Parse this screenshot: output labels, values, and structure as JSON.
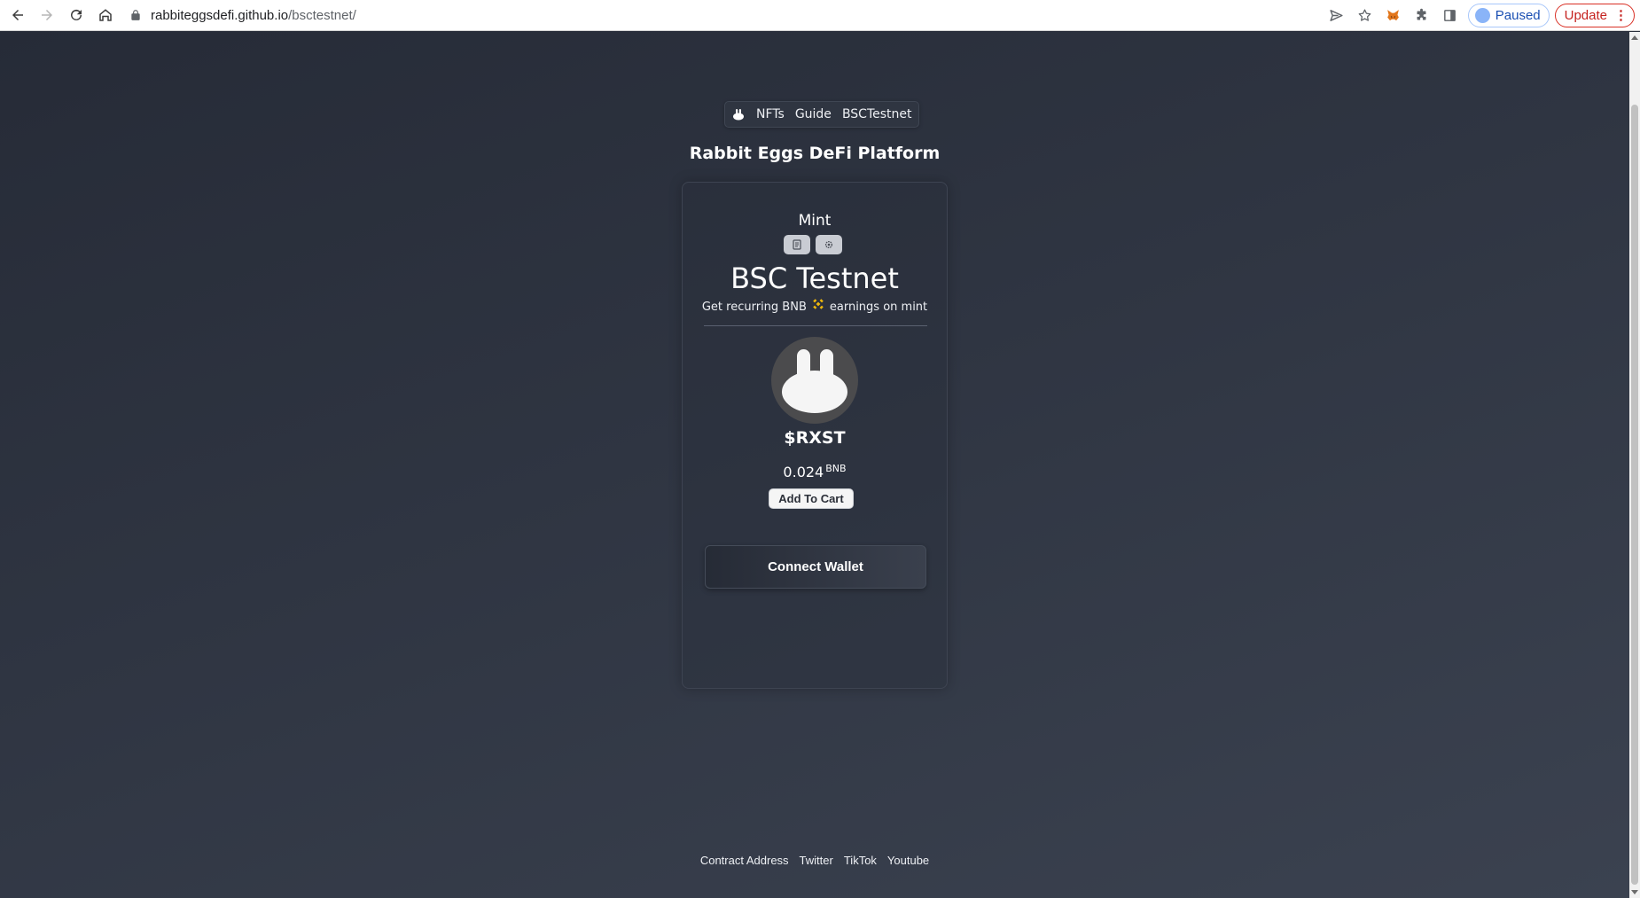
{
  "browser": {
    "url_host": "rabbiteggsdefi.github.io",
    "url_path": "/bsctestnet/",
    "profile_label": "Paused",
    "update_label": "Update"
  },
  "nav": {
    "links": [
      "NFTs",
      "Guide",
      "BSCTestnet"
    ]
  },
  "site_title": "Rabbit Eggs DeFi Platform",
  "card": {
    "mint_label": "Mint",
    "network_title": "BSC Testnet",
    "earnings_prefix": "Get recurring BNB",
    "earnings_suffix": "earnings on mint",
    "token_name": "$RXST",
    "price_value": "0.024",
    "price_unit": "BNB",
    "add_to_cart_label": "Add To Cart",
    "connect_wallet_label": "Connect Wallet"
  },
  "footer": {
    "links": [
      "Contract Address",
      "Twitter",
      "TikTok",
      "Youtube"
    ]
  },
  "colors": {
    "bnb_yellow": "#f0b90b",
    "update_red": "#d93025",
    "paused_blue": "#1a4fb3"
  }
}
